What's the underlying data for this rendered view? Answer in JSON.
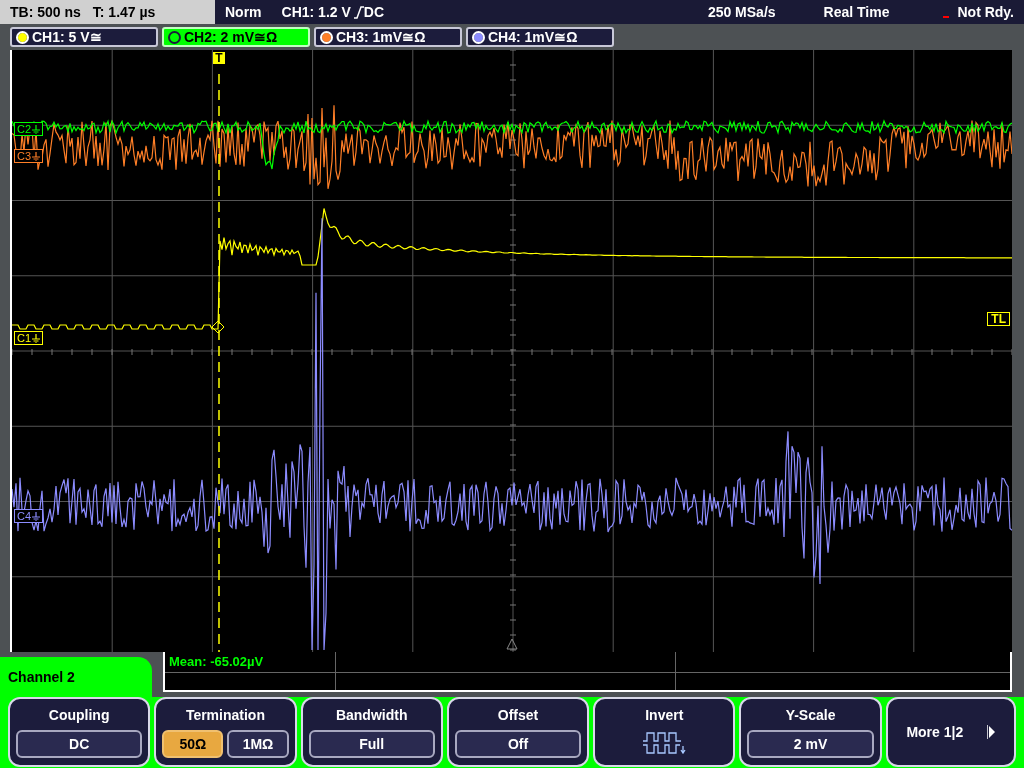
{
  "status_bar": {
    "timebase": "TB: 500 ns",
    "trigger_time": "T: 1.47 µs",
    "mode": "Norm",
    "trigger_source": "CH1: 1.2 V",
    "trigger_coupling": "DC",
    "sample_rate": "250 MSa/s",
    "acquisition": "Real Time",
    "state": "Not Rdy."
  },
  "channels": [
    {
      "label": "CH1: 5 V≅",
      "color": "#ffff00",
      "selected": false
    },
    {
      "label": "CH2: 2 mV≅Ω",
      "color": "#00ff00",
      "selected": true
    },
    {
      "label": "CH3: 1mV≅Ω",
      "color": "#ff7f27",
      "selected": false
    },
    {
      "label": "CH4: 1mV≅Ω",
      "color": "#8c8cff",
      "selected": false
    }
  ],
  "markers": [
    {
      "label": "C2",
      "color": "#00ff00"
    },
    {
      "label": "C3",
      "color": "#ff7f27"
    },
    {
      "label": "C1",
      "color": "#ffff00"
    },
    {
      "label": "C4",
      "color": "#8c8cff"
    }
  ],
  "trigger_marker": "T",
  "trigger_level_marker": "TL",
  "measurement": "Mean: -65.02µV",
  "menu": {
    "title": "Channel 2",
    "softkeys": [
      {
        "kind": "value",
        "label": "Coupling",
        "value": "DC"
      },
      {
        "kind": "choice",
        "label": "Termination",
        "options": [
          {
            "label": "50Ω",
            "selected": true
          },
          {
            "label": "1MΩ",
            "selected": false
          }
        ]
      },
      {
        "kind": "value",
        "label": "Bandwidth",
        "value": "Full"
      },
      {
        "kind": "value",
        "label": "Offset",
        "value": "Off"
      },
      {
        "kind": "invert",
        "label": "Invert"
      },
      {
        "kind": "value",
        "label": "Y-Scale",
        "value": "2 mV"
      },
      {
        "kind": "more",
        "label": "More 1|2"
      }
    ]
  }
}
